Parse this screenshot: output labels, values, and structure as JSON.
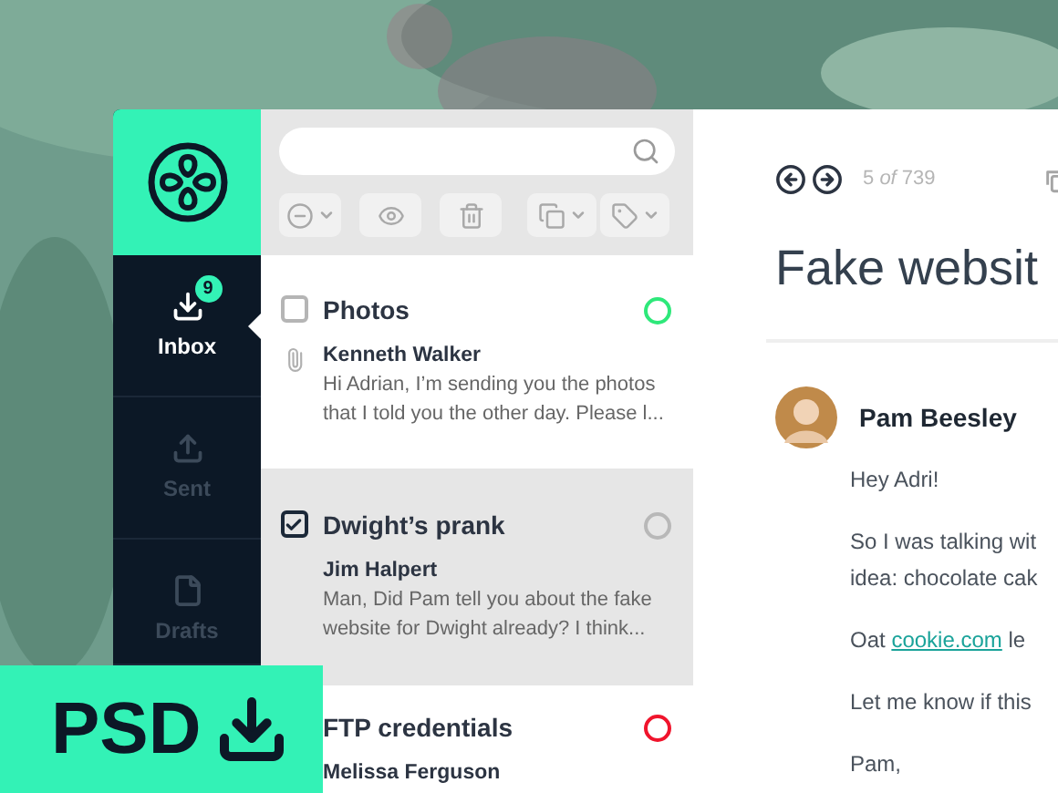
{
  "sidebar": {
    "items": [
      {
        "label": "Inbox",
        "selected": true,
        "badge": "9",
        "kind": "inbox"
      },
      {
        "label": "Sent",
        "selected": false,
        "kind": "sent"
      },
      {
        "label": "Drafts",
        "selected": false,
        "kind": "drafts"
      }
    ]
  },
  "messages": [
    {
      "subject": "Photos",
      "checked": false,
      "selected": false,
      "attachment": true,
      "sender": "Kenneth Walker",
      "preview": "Hi Adrian, I’m sending you the photos that I told you the other day. Please l...",
      "color": "#2ee87a"
    },
    {
      "subject": "Dwight’s prank",
      "checked": true,
      "selected": true,
      "attachment": false,
      "sender": "Jim Halpert",
      "preview": "Man, Did Pam tell you about the fake website for Dwight already? I think...",
      "color": "#b8b8b8"
    },
    {
      "subject": "FTP credentials",
      "selected": false,
      "sender": "Melissa Ferguson",
      "color": "#f0142c"
    }
  ],
  "reader": {
    "counter": "5 *of* 739",
    "subject": "Fake websit",
    "author": "Pam Beesley",
    "body": [
      {
        "kind": "text",
        "lines": [
          "Hey Adri!"
        ]
      },
      {
        "kind": "text",
        "lines": [
          "So I was talking wit",
          "idea: chocolate cak"
        ]
      },
      {
        "kind": "link",
        "before": "Oat ",
        "link": "cookie.com",
        "after": " le"
      },
      {
        "kind": "text",
        "lines": [
          "Let me know if this"
        ]
      },
      {
        "kind": "text",
        "lines": [
          "Pam,"
        ]
      }
    ]
  },
  "download_badge": {
    "label": "PSD"
  }
}
